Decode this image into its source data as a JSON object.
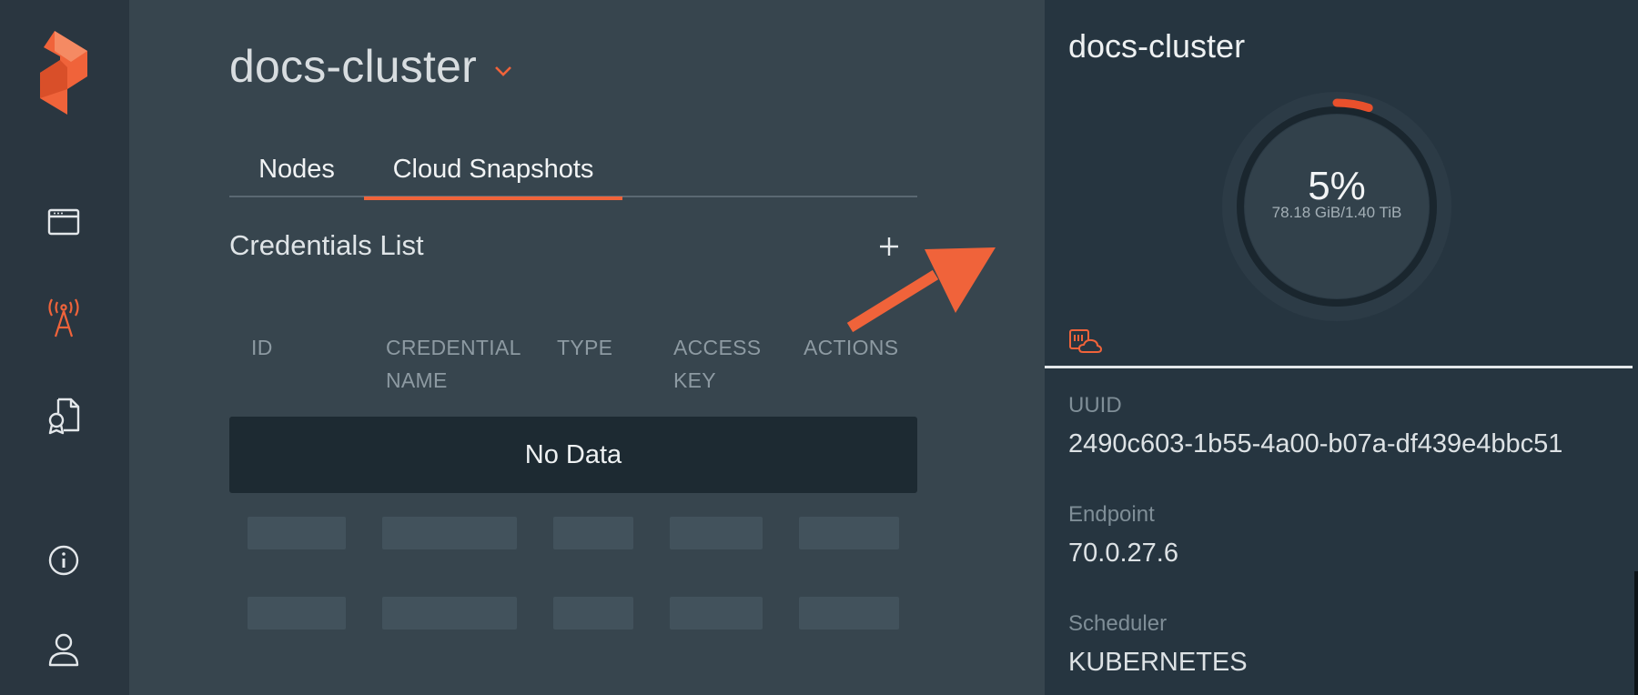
{
  "colors": {
    "accent": "#f0633a",
    "rail_bg": "#2a3640",
    "main_bg": "#37454e",
    "panel_bg": "#263540",
    "no_data_bg": "#1d2a32"
  },
  "sidebar": {
    "logo": "portworx-logo",
    "items": [
      {
        "icon": "dashboard-window-icon",
        "active": false
      },
      {
        "icon": "antenna-tower-icon",
        "active": true
      },
      {
        "icon": "certificate-document-icon",
        "active": false
      },
      {
        "icon": "info-icon",
        "active": false
      },
      {
        "icon": "user-icon",
        "active": false
      }
    ]
  },
  "header": {
    "cluster_name": "docs-cluster",
    "dropdown_icon": "chevron-down-icon"
  },
  "tabs": [
    {
      "label": "Nodes",
      "active": false
    },
    {
      "label": "Cloud Snapshots",
      "active": true
    }
  ],
  "credentials": {
    "title": "Credentials List",
    "add_icon": "plus-icon",
    "columns": [
      {
        "line1": "",
        "line2": "ID"
      },
      {
        "line1": "CREDENTIAL",
        "line2": "NAME"
      },
      {
        "line1": "",
        "line2": "TYPE"
      },
      {
        "line1": "ACCESS",
        "line2": "KEY"
      },
      {
        "line1": "",
        "line2": "ACTIONS"
      }
    ],
    "empty_text": "No Data",
    "placeholder_rows": 2
  },
  "cluster_panel": {
    "title": "docs-cluster",
    "usage": {
      "percent_label": "5%",
      "fraction": 0.05,
      "detail": "78.18 GiB/1.40 TiB"
    },
    "storage_icon": "cloud-storage-icon",
    "fields": [
      {
        "label": "UUID",
        "value": "2490c603-1b55-4a00-b07a-df439e4bbc51"
      },
      {
        "label": "Endpoint",
        "value": "70.0.27.6"
      },
      {
        "label": "Scheduler",
        "value": "KUBERNETES"
      }
    ]
  }
}
